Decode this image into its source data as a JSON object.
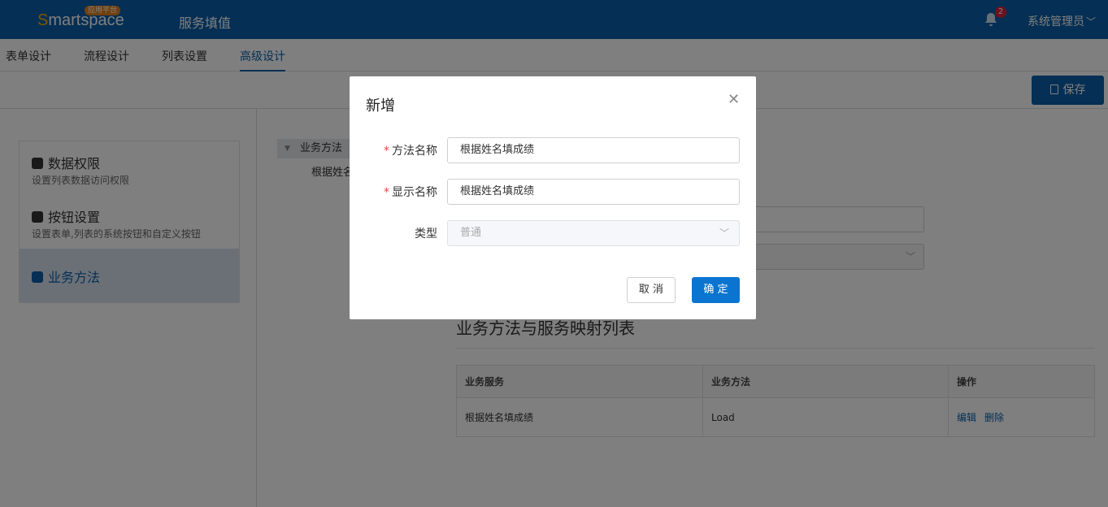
{
  "header": {
    "logo_text_s": "S",
    "logo_text_rest": "martspace",
    "logo_badge": "应用平台",
    "app_title": "服务填值",
    "notification_count": "2",
    "user_name": "系统管理员"
  },
  "tabs": [
    {
      "label": "表单设计"
    },
    {
      "label": "流程设计"
    },
    {
      "label": "列表设置"
    },
    {
      "label": "高级设计"
    }
  ],
  "toolbar": {
    "save_label": "保存"
  },
  "side_menu": [
    {
      "title": "数据权限",
      "desc": "设置列表数据访问权限"
    },
    {
      "title": "按钮设置",
      "desc": "设置表单,列表的系统按钮和自定义按钮"
    },
    {
      "title": "业务方法",
      "desc": ""
    }
  ],
  "tree": {
    "root": "业务方法",
    "child": "根据姓名"
  },
  "mapping": {
    "title": "业务方法与服务映射列表",
    "columns": [
      "业务服务",
      "业务方法",
      "操作"
    ],
    "rows": [
      {
        "service": "根据姓名填成绩",
        "method": "Load",
        "edit": "编辑",
        "delete": "删除"
      }
    ]
  },
  "dialog": {
    "title": "新增",
    "method_name_label": "方法名称",
    "method_name_value": "根据姓名填成绩",
    "display_name_label": "显示名称",
    "display_name_value": "根据姓名填成绩",
    "type_label": "类型",
    "type_value": "普通",
    "cancel_label": "取 消",
    "ok_label": "确 定"
  },
  "colors": {
    "brand": "#0a5fa8",
    "primary_button": "#0a74d0",
    "required": "#e04a4a"
  }
}
